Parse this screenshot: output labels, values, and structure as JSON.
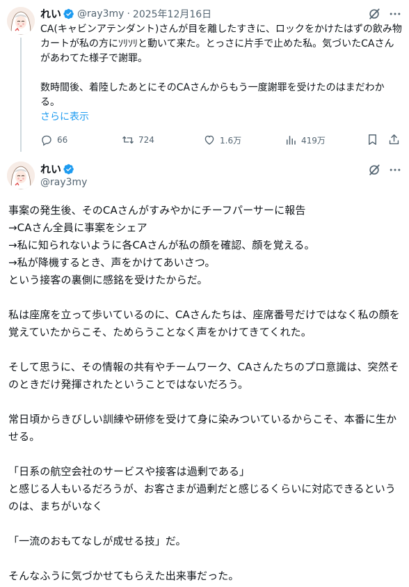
{
  "reply": {
    "display_name": "れい",
    "handle": "@ray3my",
    "separator": "·",
    "date": "2025年12月16日",
    "text": "CA(キャビンアテンダント)さんが目を離したすきに、ロックをかけたはずの飲み物カートが私の方にｿﾘｿﾘと動いて来た。とっさに片手で止めた私。気づいたCAさんがあわてた様子で謝罪。\n\n数時間後、着陸したあとにそのCAさんからもう一度謝罪を受けたのはまだわかる。",
    "show_more": "さらに表示",
    "stats": {
      "replies": "66",
      "reposts": "724",
      "likes": "1.6万",
      "views": "419万"
    }
  },
  "main_post": {
    "display_name": "れい",
    "handle": "@ray3my",
    "text": "事案の発生後、そのCAさんがすみやかにチーフパーサーに報告\n→CAさん全員に事案をシェア\n→私に知られないように各CAさんが私の顔を確認、顔を覚える。\n→私が降機するとき、声をかけてあいさつ。\nという接客の裏側に感銘を受けたからだ。\n\n私は座席を立って歩いているのに、CAさんたちは、座席番号だけではなく私の顔を覚えていたからこそ、ためらうことなく声をかけてきてくれた。\n\nそして思うに、その情報の共有やチームワーク、CAさんたちのプロ意識は、突然そのときだけ発揮されたということではないだろう。\n\n常日頃からきびしい訓練や研修を受けて身に染みついているからこそ、本番に生かせる。\n\n「日系の航空会社のサービスや接客は過剰である」\nと感じる人もいるだろうが、お客さまが過剰だと感じるくらいに対応できるというのは、まちがいなく\n\n「一流のおもてなしが成せる技」だ。\n\nそんなふうに気づかせてもらえた出来事だった。"
  },
  "colors": {
    "text": "#0f1419",
    "secondary": "#536471",
    "accent": "#1d9bf0",
    "thread_line": "#cfd9de"
  },
  "icons": [
    "verified-badge-icon",
    "grok-icon",
    "more-icon",
    "reply-icon",
    "repost-icon",
    "like-icon",
    "views-icon",
    "bookmark-icon",
    "share-icon"
  ]
}
